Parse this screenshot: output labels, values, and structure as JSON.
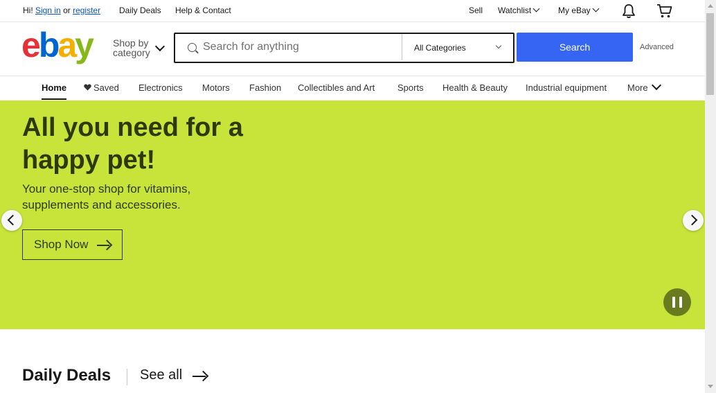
{
  "topbar": {
    "greeting": "Hi!",
    "sign_in": "Sign in",
    "or": "or",
    "register": "register",
    "daily_deals": "Daily Deals",
    "help_contact": "Help & Contact",
    "sell": "Sell",
    "watchlist": "Watchlist",
    "my_ebay": "My eBay",
    "icons": [
      "bell-icon",
      "cart-icon"
    ]
  },
  "header": {
    "logo": {
      "e": "e",
      "b": "b",
      "a": "a",
      "y": "y"
    },
    "shop_by_line1": "Shop by",
    "shop_by_line2": "category",
    "search_placeholder": "Search for anything",
    "category_selected": "All Categories",
    "search_button": "Search",
    "advanced": "Advanced"
  },
  "nav": {
    "items": [
      "Home",
      "Saved",
      "Electronics",
      "Motors",
      "Fashion",
      "Collectibles and Art",
      "Sports",
      "Health & Beauty",
      "Industrial equipment",
      "More"
    ]
  },
  "hero": {
    "title": "All you need for a happy pet!",
    "subtitle": "Your one-stop shop for vitamins, supplements and accessories.",
    "cta": "Shop Now",
    "background_color": "#c8e33a"
  },
  "deals": {
    "title": "Daily Deals",
    "see_all": "See all"
  },
  "colors": {
    "brand_blue": "#3665f3",
    "link": "#0654ba",
    "logo_red": "#e53238",
    "logo_blue": "#0064d2",
    "logo_yellow": "#f5af02",
    "logo_green": "#86b817"
  }
}
